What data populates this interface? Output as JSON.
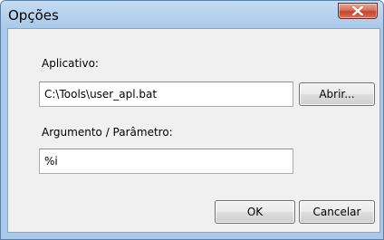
{
  "window": {
    "title": "Opções"
  },
  "form": {
    "app_label": "Aplicativo:",
    "app_value": "C:\\Tools\\user_apl.bat",
    "browse_label": "Abrir...",
    "arg_label": "Argumento / Parâmetro:",
    "arg_value": "%i"
  },
  "buttons": {
    "ok": "OK",
    "cancel": "Cancelar"
  },
  "icons": {
    "close": "close-icon"
  }
}
